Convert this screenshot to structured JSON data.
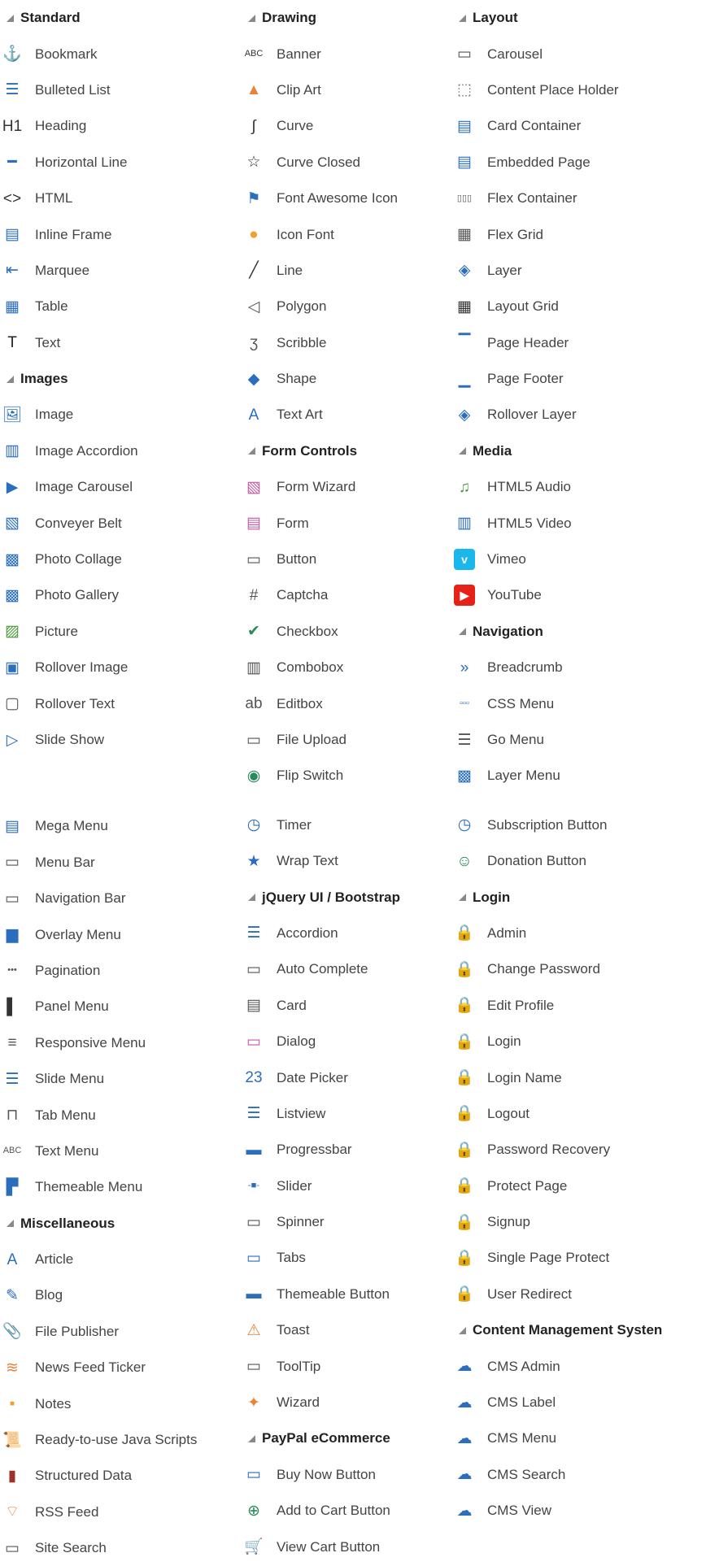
{
  "col1": [
    {
      "type": "h",
      "label": "Standard"
    },
    {
      "label": "Bookmark",
      "icon": "anchor-icon",
      "g": "⚓",
      "c": "#555"
    },
    {
      "label": "Bulleted List",
      "icon": "bulleted-list-icon",
      "g": "☰",
      "c": "#2a6ebd"
    },
    {
      "label": "Heading",
      "icon": "heading-icon",
      "g": "H1",
      "c": "#333"
    },
    {
      "label": "Horizontal Line",
      "icon": "horizontal-line-icon",
      "g": "━",
      "c": "#2a6ebd"
    },
    {
      "label": "HTML",
      "icon": "html-code-icon",
      "g": "<>",
      "c": "#333"
    },
    {
      "label": "Inline Frame",
      "icon": "inline-frame-icon",
      "g": "▤",
      "c": "#2a6ebd"
    },
    {
      "label": "Marquee",
      "icon": "marquee-icon",
      "g": "⇤",
      "c": "#2a6ebd"
    },
    {
      "label": "Table",
      "icon": "table-icon",
      "g": "▦",
      "c": "#2a6ebd"
    },
    {
      "label": "Text",
      "icon": "text-icon",
      "g": "T",
      "c": "#222"
    },
    {
      "type": "h",
      "label": "Images"
    },
    {
      "label": "Image",
      "icon": "image-icon",
      "g": "🖼",
      "c": "#2a6ebd"
    },
    {
      "label": "Image Accordion",
      "icon": "image-accordion-icon",
      "g": "▥",
      "c": "#2a6ebd"
    },
    {
      "label": "Image Carousel",
      "icon": "image-carousel-icon",
      "g": "▶",
      "c": "#2a6ebd"
    },
    {
      "label": "Conveyer Belt",
      "icon": "conveyer-belt-icon",
      "g": "▧",
      "c": "#2a6ebd"
    },
    {
      "label": "Photo Collage",
      "icon": "photo-collage-icon",
      "g": "▩",
      "c": "#2a6ebd"
    },
    {
      "label": "Photo Gallery",
      "icon": "photo-gallery-icon",
      "g": "▩",
      "c": "#2a6ebd"
    },
    {
      "label": "Picture",
      "icon": "picture-icon",
      "g": "▨",
      "c": "#4a9a3a"
    },
    {
      "label": "Rollover Image",
      "icon": "rollover-image-icon",
      "g": "▣",
      "c": "#2a6ebd"
    },
    {
      "label": "Rollover Text",
      "icon": "rollover-text-icon",
      "g": "▢",
      "c": "#555"
    },
    {
      "label": "Slide Show",
      "icon": "slide-show-icon",
      "g": "▷",
      "c": "#2a6ebd"
    },
    {
      "type": "space"
    },
    {
      "label": "Mega Menu",
      "icon": "mega-menu-icon",
      "g": "▤",
      "c": "#2a6ebd"
    },
    {
      "label": "Menu Bar",
      "icon": "menu-bar-icon",
      "g": "▭",
      "c": "#555"
    },
    {
      "label": "Navigation Bar",
      "icon": "navigation-bar-icon",
      "g": "▭",
      "c": "#555"
    },
    {
      "label": "Overlay Menu",
      "icon": "overlay-menu-icon",
      "g": "▆",
      "c": "#2a6ebd"
    },
    {
      "label": "Pagination",
      "icon": "pagination-icon",
      "g": "•••",
      "c": "#555"
    },
    {
      "label": "Panel Menu",
      "icon": "panel-menu-icon",
      "g": "▌",
      "c": "#333"
    },
    {
      "label": "Responsive Menu",
      "icon": "responsive-menu-icon",
      "g": "≡",
      "c": "#555"
    },
    {
      "label": "Slide Menu",
      "icon": "slide-menu-icon",
      "g": "☰",
      "c": "#2a6ebd"
    },
    {
      "label": "Tab Menu",
      "icon": "tab-menu-icon",
      "g": "⊓",
      "c": "#555"
    },
    {
      "label": "Text Menu",
      "icon": "text-menu-icon",
      "g": "ABC",
      "c": "#555"
    },
    {
      "label": "Themeable Menu",
      "icon": "themeable-menu-icon",
      "g": "▛",
      "c": "#2a6ebd"
    },
    {
      "type": "h",
      "label": "Miscellaneous"
    },
    {
      "label": "Article",
      "icon": "article-icon",
      "g": "A",
      "c": "#2a6ebd"
    },
    {
      "label": "Blog",
      "icon": "blog-icon",
      "g": "✎",
      "c": "#2a6ebd"
    },
    {
      "label": "File Publisher",
      "icon": "file-publisher-icon",
      "g": "📎",
      "c": "#555"
    },
    {
      "label": "News Feed Ticker",
      "icon": "news-feed-ticker-icon",
      "g": "≋",
      "c": "#e8843a"
    },
    {
      "label": "Notes",
      "icon": "notes-icon",
      "g": "▪",
      "c": "#f0a030"
    },
    {
      "label": "Ready-to-use Java Scripts",
      "icon": "script-scroll-icon",
      "g": "📜",
      "c": "#555"
    },
    {
      "label": "Structured Data",
      "icon": "structured-data-icon",
      "g": "▮",
      "c": "#a0302a"
    },
    {
      "label": "RSS Feed",
      "icon": "rss-feed-icon",
      "g": "⌔",
      "c": "#e8843a"
    },
    {
      "label": "Site Search",
      "icon": "site-search-icon",
      "g": "▭",
      "c": "#555"
    }
  ],
  "col2": [
    {
      "type": "h",
      "label": "Drawing"
    },
    {
      "label": "Banner",
      "icon": "banner-icon",
      "g": "ABC",
      "c": "#333"
    },
    {
      "label": "Clip Art",
      "icon": "clip-art-icon",
      "g": "▲",
      "c": "#e8843a"
    },
    {
      "label": "Curve",
      "icon": "curve-icon",
      "g": "∫",
      "c": "#333"
    },
    {
      "label": "Curve Closed",
      "icon": "curve-closed-icon",
      "g": "☆",
      "c": "#333"
    },
    {
      "label": "Font Awesome Icon",
      "icon": "flag-icon",
      "g": "⚑",
      "c": "#2a6ebd"
    },
    {
      "label": "Icon Font",
      "icon": "lightbulb-icon",
      "g": "●",
      "c": "#f0a030"
    },
    {
      "label": "Line",
      "icon": "line-icon",
      "g": "╱",
      "c": "#333"
    },
    {
      "label": "Polygon",
      "icon": "polygon-icon",
      "g": "◁",
      "c": "#555"
    },
    {
      "label": "Scribble",
      "icon": "scribble-icon",
      "g": "ʒ",
      "c": "#555"
    },
    {
      "label": "Shape",
      "icon": "shape-icon",
      "g": "◆",
      "c": "#2a6ebd"
    },
    {
      "label": "Text Art",
      "icon": "text-art-icon",
      "g": "A",
      "c": "#2a6ebd"
    },
    {
      "type": "h",
      "label": "Form Controls"
    },
    {
      "label": "Form Wizard",
      "icon": "form-wizard-icon",
      "g": "▧",
      "c": "#c05aa0"
    },
    {
      "label": "Form",
      "icon": "form-icon",
      "g": "▤",
      "c": "#c05aa0"
    },
    {
      "label": "Button",
      "icon": "button-icon",
      "g": "▭",
      "c": "#555"
    },
    {
      "label": "Captcha",
      "icon": "captcha-icon",
      "g": "#",
      "c": "#555"
    },
    {
      "label": "Checkbox",
      "icon": "checkbox-icon",
      "g": "✔",
      "c": "#2a8a5a"
    },
    {
      "label": "Combobox",
      "icon": "combobox-icon",
      "g": "▥",
      "c": "#555"
    },
    {
      "label": "Editbox",
      "icon": "editbox-icon",
      "g": "ab",
      "c": "#555"
    },
    {
      "label": "File Upload",
      "icon": "file-upload-icon",
      "g": "▭",
      "c": "#555"
    },
    {
      "label": "Flip Switch",
      "icon": "flip-switch-icon",
      "g": "◉",
      "c": "#2a8a5a"
    },
    {
      "type": "space"
    },
    {
      "label": "Timer",
      "icon": "timer-icon",
      "g": "◷",
      "c": "#2a6ebd"
    },
    {
      "label": "Wrap Text",
      "icon": "wrap-text-icon",
      "g": "★",
      "c": "#2a6ebd"
    },
    {
      "type": "h",
      "label": "jQuery UI / Bootstrap"
    },
    {
      "label": "Accordion",
      "icon": "accordion-icon",
      "g": "☰",
      "c": "#2a6ebd"
    },
    {
      "label": "Auto Complete",
      "icon": "auto-complete-icon",
      "g": "▭",
      "c": "#555"
    },
    {
      "label": "Card",
      "icon": "card-icon",
      "g": "▤",
      "c": "#555"
    },
    {
      "label": "Dialog",
      "icon": "dialog-icon",
      "g": "▭",
      "c": "#c05aa0"
    },
    {
      "label": "Date Picker",
      "icon": "date-picker-icon",
      "g": "23",
      "c": "#2a6ebd"
    },
    {
      "label": "Listview",
      "icon": "listview-icon",
      "g": "☰",
      "c": "#2a6ebd"
    },
    {
      "label": "Progressbar",
      "icon": "progressbar-icon",
      "g": "▬",
      "c": "#2a6ebd"
    },
    {
      "label": "Slider",
      "icon": "slider-icon",
      "g": "-■-",
      "c": "#2a6ebd"
    },
    {
      "label": "Spinner",
      "icon": "spinner-icon",
      "g": "▭",
      "c": "#555"
    },
    {
      "label": "Tabs",
      "icon": "tabs-icon",
      "g": "▭",
      "c": "#2a6ebd"
    },
    {
      "label": "Themeable Button",
      "icon": "themeable-button-icon",
      "g": "▬",
      "c": "#2a6ebd"
    },
    {
      "label": "Toast",
      "icon": "toast-icon",
      "g": "⚠",
      "c": "#e8843a"
    },
    {
      "label": "ToolTip",
      "icon": "tooltip-icon",
      "g": "▭",
      "c": "#555"
    },
    {
      "label": "Wizard",
      "icon": "wizard-wand-icon",
      "g": "✦",
      "c": "#e8843a"
    },
    {
      "type": "h",
      "label": "PayPal eCommerce"
    },
    {
      "label": "Buy Now Button",
      "icon": "buy-now-icon",
      "g": "▭",
      "c": "#2a6ebd"
    },
    {
      "label": "Add to Cart Button",
      "icon": "add-to-cart-icon",
      "g": "⊕",
      "c": "#2a8a5a"
    },
    {
      "label": "View Cart Button",
      "icon": "view-cart-icon",
      "g": "🛒",
      "c": "#2a6ebd"
    }
  ],
  "col3": [
    {
      "type": "h",
      "label": "Layout"
    },
    {
      "label": "Carousel",
      "icon": "carousel-icon",
      "g": "▭",
      "c": "#555"
    },
    {
      "label": "Content Place Holder",
      "icon": "content-placeholder-icon",
      "g": "⬚",
      "c": "#777"
    },
    {
      "label": "Card Container",
      "icon": "card-container-icon",
      "g": "▤",
      "c": "#2a6ebd"
    },
    {
      "label": "Embedded Page",
      "icon": "embedded-page-icon",
      "g": "▤",
      "c": "#2a6ebd"
    },
    {
      "label": "Flex Container",
      "icon": "flex-container-icon",
      "g": "▯▯▯",
      "c": "#555"
    },
    {
      "label": "Flex Grid",
      "icon": "flex-grid-icon",
      "g": "▦",
      "c": "#555"
    },
    {
      "label": "Layer",
      "icon": "layer-icon",
      "g": "◈",
      "c": "#2a6ebd"
    },
    {
      "label": "Layout Grid",
      "icon": "layout-grid-icon",
      "g": "▦",
      "c": "#333"
    },
    {
      "label": "Page Header",
      "icon": "page-header-icon",
      "g": "▔",
      "c": "#2a6ebd"
    },
    {
      "label": "Page Footer",
      "icon": "page-footer-icon",
      "g": "▁",
      "c": "#2a6ebd"
    },
    {
      "label": "Rollover Layer",
      "icon": "rollover-layer-icon",
      "g": "◈",
      "c": "#2a6ebd"
    },
    {
      "type": "h",
      "label": "Media"
    },
    {
      "label": "HTML5 Audio",
      "icon": "music-note-icon",
      "g": "♫",
      "c": "#4a9a3a"
    },
    {
      "label": "HTML5 Video",
      "icon": "film-icon",
      "g": "▥",
      "c": "#2a6ebd"
    },
    {
      "label": "Vimeo",
      "icon": "vimeo-icon",
      "g": "v",
      "c": "#ffffff",
      "bg": "#1ab7ea"
    },
    {
      "label": "YouTube",
      "icon": "youtube-icon",
      "g": "▶",
      "c": "#ffffff",
      "bg": "#e62117"
    },
    {
      "type": "h",
      "label": "Navigation"
    },
    {
      "label": "Breadcrumb",
      "icon": "breadcrumb-icon",
      "g": "»",
      "c": "#2a6ebd"
    },
    {
      "label": "CSS Menu",
      "icon": "css-menu-icon",
      "g": "▫▫▫",
      "c": "#2a6ebd"
    },
    {
      "label": "Go Menu",
      "icon": "go-menu-icon",
      "g": "☰",
      "c": "#555"
    },
    {
      "label": "Layer Menu",
      "icon": "layer-menu-icon",
      "g": "▩",
      "c": "#2a6ebd"
    },
    {
      "type": "space"
    },
    {
      "label": "Subscription Button",
      "icon": "subscription-button-icon",
      "g": "◷",
      "c": "#2a6ebd"
    },
    {
      "label": "Donation Button",
      "icon": "donation-button-icon",
      "g": "☺",
      "c": "#2a8a5a"
    },
    {
      "type": "h",
      "label": "Login"
    },
    {
      "label": "Admin",
      "icon": "admin-lock-icon",
      "g": "🔒",
      "c": "#2a6ebd"
    },
    {
      "label": "Change Password",
      "icon": "change-password-icon",
      "g": "🔒",
      "c": "#2a6ebd"
    },
    {
      "label": "Edit Profile",
      "icon": "edit-profile-icon",
      "g": "🔒",
      "c": "#2a6ebd"
    },
    {
      "label": "Login",
      "icon": "login-lock-icon",
      "g": "🔒",
      "c": "#2a8a5a"
    },
    {
      "label": "Login Name",
      "icon": "login-name-icon",
      "g": "🔒",
      "c": "#2a6ebd"
    },
    {
      "label": "Logout",
      "icon": "logout-lock-icon",
      "g": "🔒",
      "c": "#d9442a"
    },
    {
      "label": "Password Recovery",
      "icon": "password-recovery-icon",
      "g": "🔒",
      "c": "#2a6ebd"
    },
    {
      "label": "Protect Page",
      "icon": "protect-page-icon",
      "g": "🔒",
      "c": "#555"
    },
    {
      "label": "Signup",
      "icon": "signup-icon",
      "g": "🔒",
      "c": "#e8843a"
    },
    {
      "label": "Single Page Protect",
      "icon": "single-page-protect-icon",
      "g": "🔒",
      "c": "#555"
    },
    {
      "label": "User Redirect",
      "icon": "user-redirect-icon",
      "g": "🔒",
      "c": "#2a6ebd"
    },
    {
      "type": "h",
      "label": "Content Management Systen"
    },
    {
      "label": "CMS Admin",
      "icon": "cms-admin-icon",
      "g": "☁",
      "c": "#2a6ebd"
    },
    {
      "label": "CMS Label",
      "icon": "cms-label-icon",
      "g": "☁",
      "c": "#2a6ebd"
    },
    {
      "label": "CMS Menu",
      "icon": "cms-menu-icon",
      "g": "☁",
      "c": "#2a6ebd"
    },
    {
      "label": "CMS Search",
      "icon": "cms-search-icon",
      "g": "☁",
      "c": "#2a6ebd"
    },
    {
      "label": "CMS View",
      "icon": "cms-view-icon",
      "g": "☁",
      "c": "#2a6ebd"
    }
  ]
}
